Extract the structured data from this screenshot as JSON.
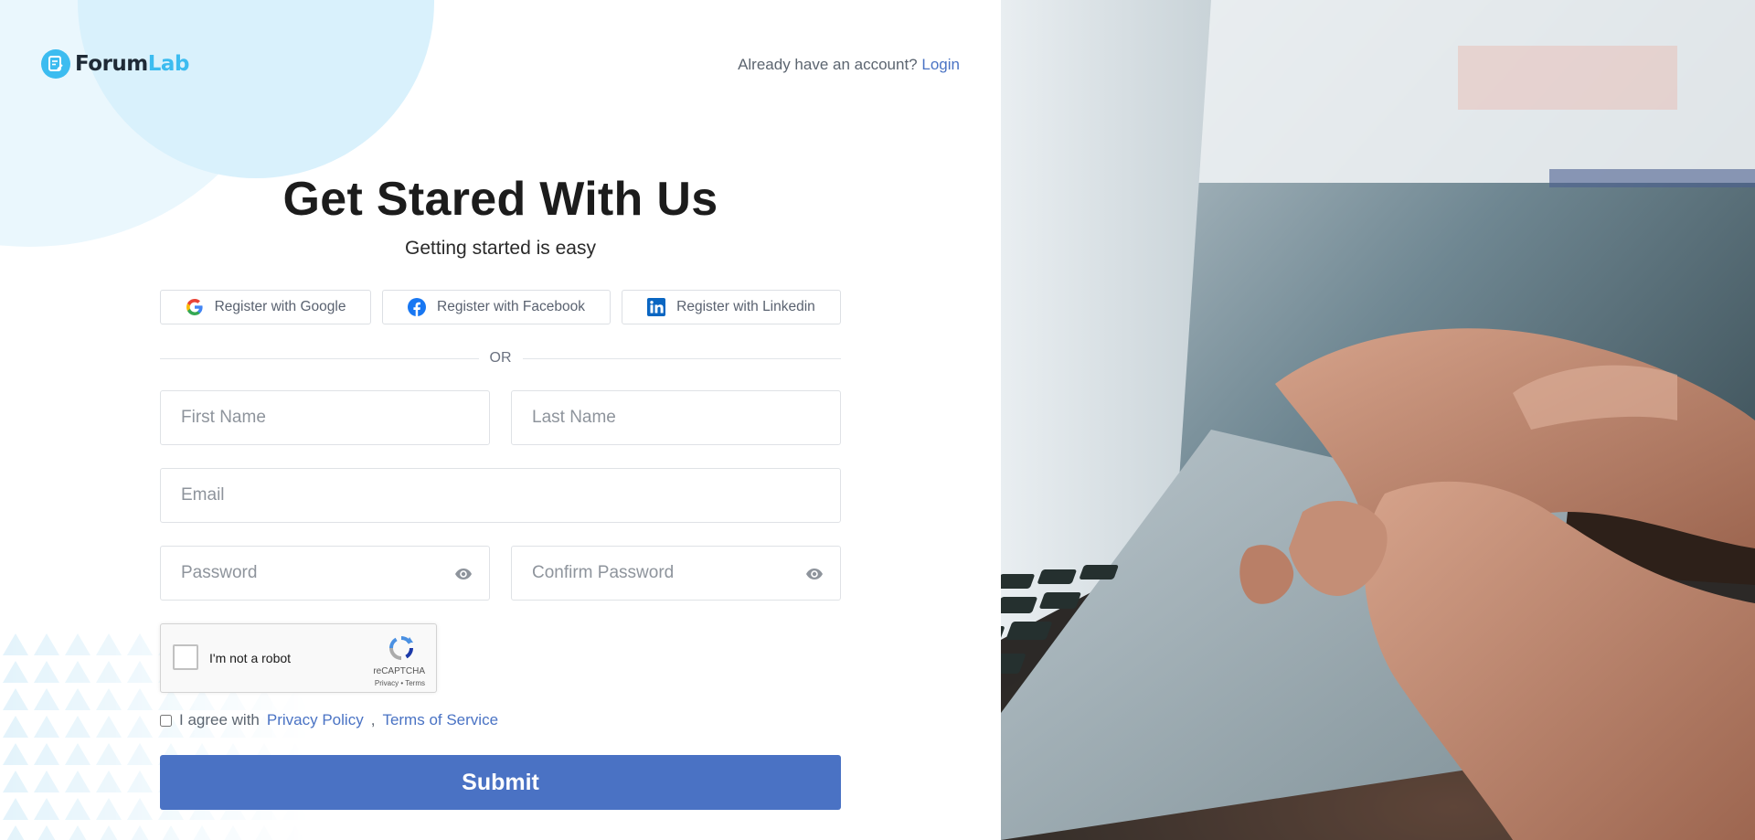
{
  "brand": {
    "name_part1": "Forum",
    "name_part2": "Lab"
  },
  "header": {
    "account_prompt": "Already have an account?",
    "login_label": "Login"
  },
  "hero": {
    "title": "Get Stared With Us",
    "subtitle": "Getting started is easy"
  },
  "social": {
    "google_label": "Register with Google",
    "facebook_label": "Register with Facebook",
    "linkedin_label": "Register with Linkedin"
  },
  "divider": {
    "label": "OR"
  },
  "form": {
    "first_name_placeholder": "First Name",
    "last_name_placeholder": "Last Name",
    "email_placeholder": "Email",
    "password_placeholder": "Password",
    "confirm_password_placeholder": "Confirm Password"
  },
  "recaptcha": {
    "label": "I'm not a robot",
    "brand": "reCAPTCHA",
    "links": "Privacy • Terms"
  },
  "agreement": {
    "prefix": "I agree with",
    "privacy_label": "Privacy Policy",
    "separator": ",",
    "terms_label": "Terms of Service"
  },
  "submit_label": "Submit",
  "colors": {
    "accent": "#4a72c4",
    "brand_blue": "#3cbcf0",
    "link": "#4a73c4"
  },
  "icons": [
    "logo-icon",
    "google-icon",
    "facebook-icon",
    "linkedin-icon",
    "eye-icon",
    "recaptcha-logo-icon"
  ]
}
